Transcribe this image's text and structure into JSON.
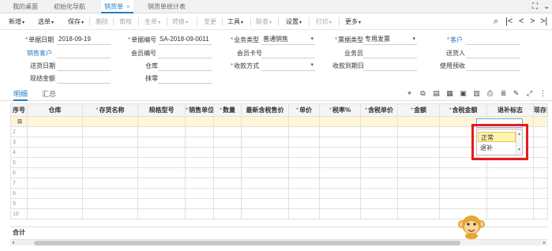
{
  "tabs": [
    {
      "label": "我的桌面"
    },
    {
      "label": "初始化导航"
    },
    {
      "label": "销货单",
      "active": true,
      "close": "×"
    },
    {
      "label": "销货单统计表"
    }
  ],
  "toolbar": {
    "items": [
      "新增",
      "选单",
      "保存",
      "删除",
      "审核",
      "生单",
      "转换",
      "变更",
      "工具",
      "联查",
      "设置",
      "打印",
      "更多"
    ],
    "caret": "▾",
    "nav_icons": [
      "⌕",
      "|<",
      "<",
      ">",
      ">|"
    ]
  },
  "form": {
    "doc_date_label": "单据日期",
    "doc_date_value": "2018-09-19",
    "doc_no_label": "单据编号",
    "doc_no_value": "SA-2018-09-0011",
    "biz_type_label": "业务类型",
    "biz_type_value": "普通销售",
    "invoice_type_label": "票据类型",
    "invoice_type_value": "专用发票",
    "customer_label": "客户",
    "sale_customer_label": "销售客户",
    "member_no_label": "会员编号",
    "member_card_label": "会员卡号",
    "salesman_label": "业务员",
    "deliverer_label": "送货人",
    "delivery_date_label": "送货日期",
    "warehouse_label": "仓库",
    "payment_label": "收款方式",
    "due_date_label": "收款到期日",
    "prepay_label": "使用预收",
    "cash_label": "现结金额",
    "discount_label": "抹零",
    "caret": "▾"
  },
  "subtabs": {
    "detail": "明细",
    "summary": "汇总"
  },
  "grid_icons": [
    "location-icon",
    "copy-icon",
    "paste-icon",
    "insert-icon",
    "save-icon",
    "delete-icon",
    "print-icon",
    "edit-icon",
    "expand-icon",
    "more-icon"
  ],
  "grid": {
    "columns": [
      {
        "label": "序号",
        "req": false
      },
      {
        "label": "仓库",
        "req": false
      },
      {
        "label": "存货名称",
        "req": true
      },
      {
        "label": "规格型号",
        "req": false
      },
      {
        "label": "销售单位",
        "req": true
      },
      {
        "label": "数量",
        "req": true
      },
      {
        "label": "最新含税售价",
        "req": false
      },
      {
        "label": "单价",
        "req": true
      },
      {
        "label": "税率%",
        "req": true
      },
      {
        "label": "含税单价",
        "req": true
      },
      {
        "label": "金额",
        "req": true
      },
      {
        "label": "含税金额",
        "req": true
      },
      {
        "label": "退补标志",
        "req": false
      },
      {
        "label": "现存量",
        "req": false
      }
    ],
    "rows": [
      "⊡",
      "2",
      "3",
      "4",
      "5",
      "6",
      "7",
      "8",
      "9",
      "10"
    ],
    "total_label": "合计"
  },
  "dropdown": {
    "options": [
      "正常",
      "退补"
    ],
    "selected": "正常",
    "caret": "⌄",
    "scroll_up": "▴",
    "scroll_down": "▾"
  },
  "scroll": {
    "left": "◂",
    "right": "▸"
  },
  "colors": {
    "accent": "#1f7dc8",
    "required": "#e84545",
    "highlight_box": "#e81a1a",
    "selected_row": "#fdf6d8"
  }
}
